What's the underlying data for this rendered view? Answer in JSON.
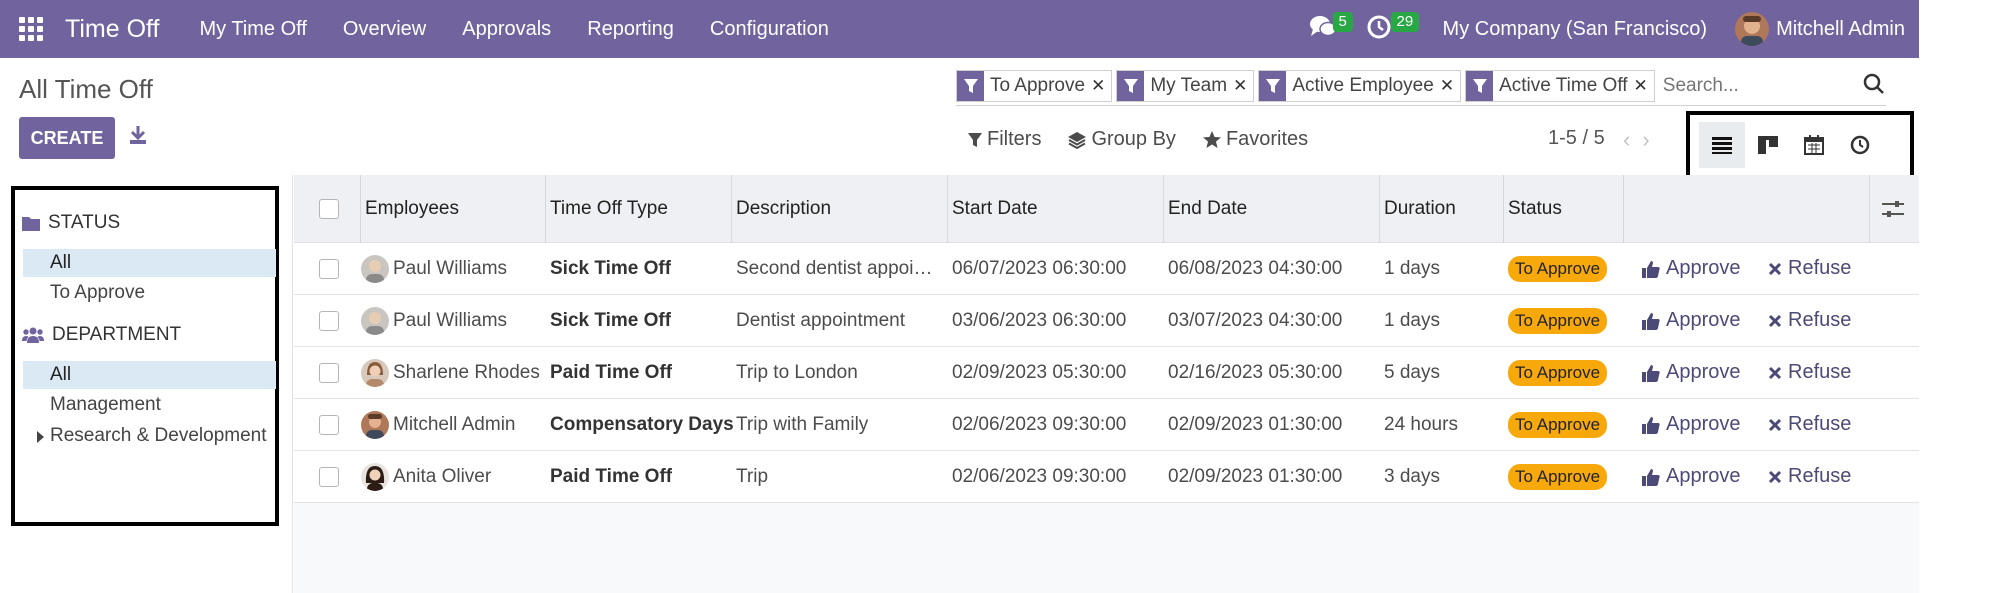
{
  "nav": {
    "app_name": "Time Off",
    "menu": [
      "My Time Off",
      "Overview",
      "Approvals",
      "Reporting",
      "Configuration"
    ],
    "messages_count": "5",
    "activities_count": "29",
    "company": "My Company (San Francisco)",
    "user": "Mitchell Admin",
    "accent": "#71639e"
  },
  "control": {
    "breadcrumb": "All Time Off",
    "create_label": "CREATE",
    "facets": [
      "To Approve",
      "My Team",
      "Active Employee",
      "Active Time Off"
    ],
    "search_placeholder": "Search...",
    "filters_label": "Filters",
    "groupby_label": "Group By",
    "favorites_label": "Favorites",
    "pager": "1-5 / 5",
    "views": [
      "list-view-icon",
      "kanban-view-icon",
      "calendar-view-icon",
      "activity-view-icon"
    ],
    "active_view": "list"
  },
  "sidepanel": {
    "status_title": "STATUS",
    "status_items": [
      "All",
      "To Approve"
    ],
    "department_title": "DEPARTMENT",
    "department_items": [
      "All",
      "Management",
      "Research & Development"
    ]
  },
  "table": {
    "columns": [
      "Employees",
      "Time Off Type",
      "Description",
      "Start Date",
      "End Date",
      "Duration",
      "Status"
    ],
    "approve_label": "Approve",
    "refuse_label": "Refuse",
    "status_color": "#f7a90c",
    "rows": [
      {
        "employee": "Paul Williams",
        "type": "Sick Time Off",
        "description": "Second dentist appoi…",
        "start": "06/07/2023 06:30:00",
        "end": "06/08/2023 04:30:00",
        "duration": "1 days",
        "status": "To Approve"
      },
      {
        "employee": "Paul Williams",
        "type": "Sick Time Off",
        "description": "Dentist appointment",
        "start": "03/06/2023 06:30:00",
        "end": "03/07/2023 04:30:00",
        "duration": "1 days",
        "status": "To Approve"
      },
      {
        "employee": "Sharlene Rhodes",
        "type": "Paid Time Off",
        "description": "Trip to London",
        "start": "02/09/2023 05:30:00",
        "end": "02/16/2023 05:30:00",
        "duration": "5 days",
        "status": "To Approve"
      },
      {
        "employee": "Mitchell Admin",
        "type": "Compensatory Days",
        "description": "Trip with Family",
        "start": "02/06/2023 09:30:00",
        "end": "02/09/2023 01:30:00",
        "duration": "24 hours",
        "status": "To Approve"
      },
      {
        "employee": "Anita Oliver",
        "type": "Paid Time Off",
        "description": "Trip",
        "start": "02/06/2023 09:30:00",
        "end": "02/09/2023 01:30:00",
        "duration": "3 days",
        "status": "To Approve"
      }
    ]
  }
}
